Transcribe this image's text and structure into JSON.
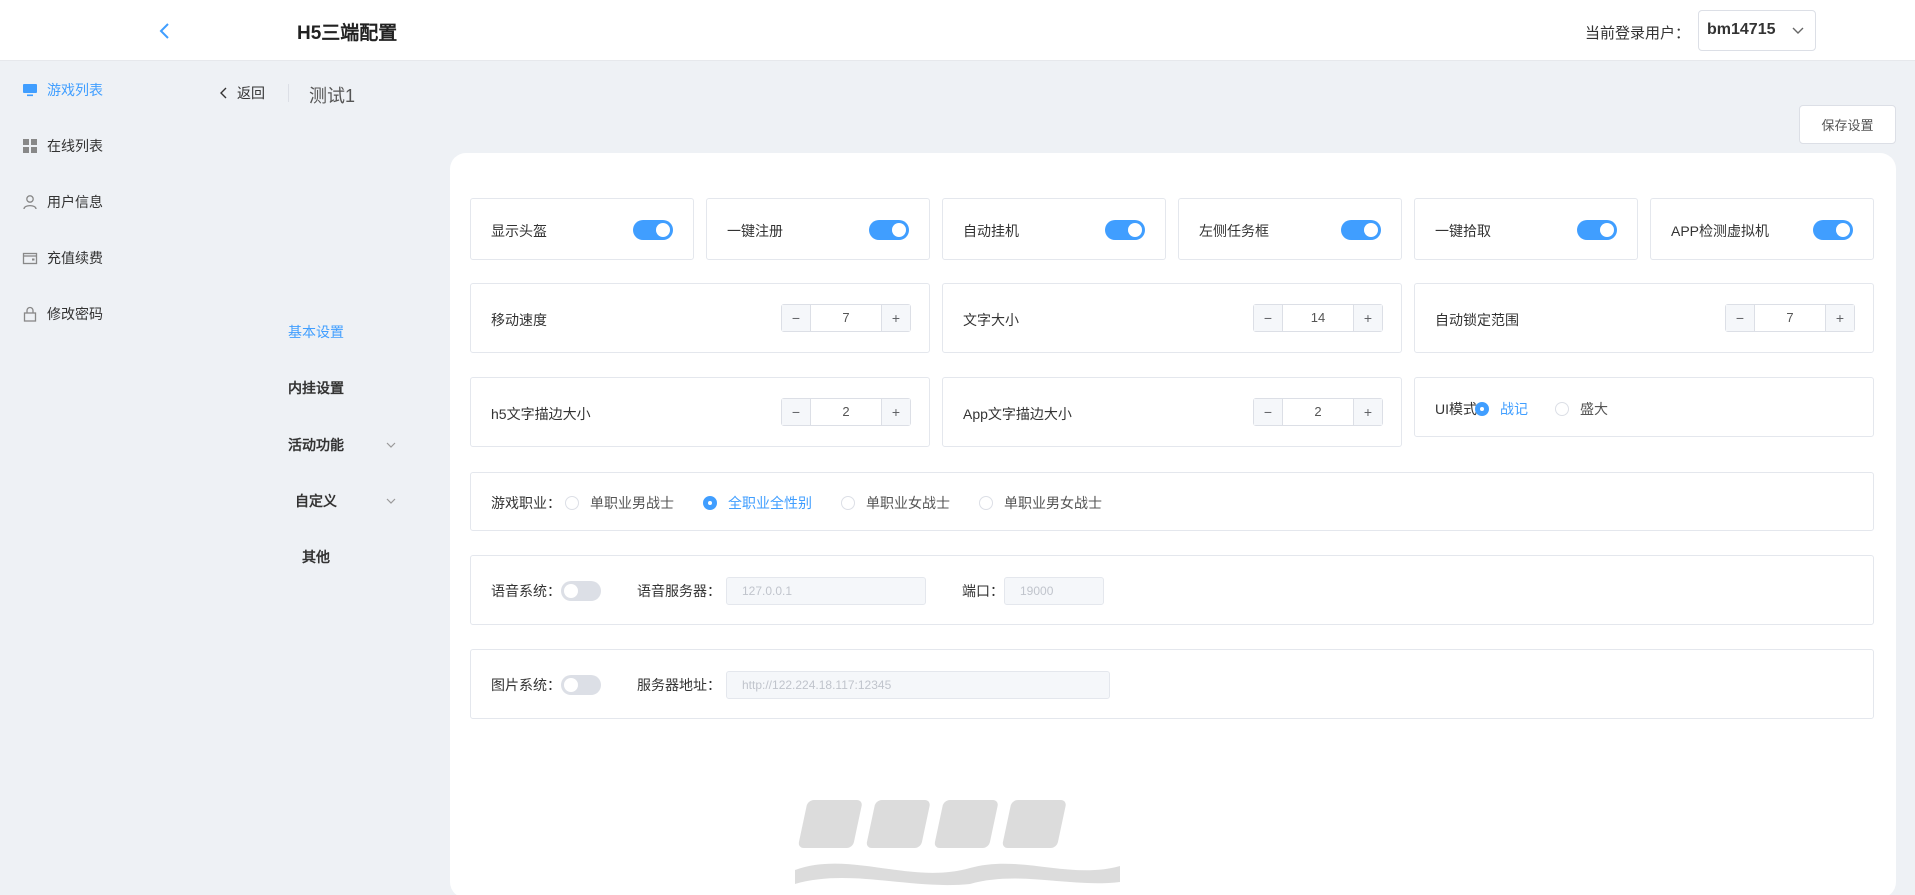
{
  "header": {
    "title": "H5三端配置",
    "user_label": "当前登录用户：",
    "user_value": "bm14715"
  },
  "sidebar": {
    "items": [
      {
        "label": "游戏列表",
        "icon": "monitor-icon"
      },
      {
        "label": "在线列表",
        "icon": "grid-icon"
      },
      {
        "label": "用户信息",
        "icon": "user-icon"
      },
      {
        "label": "充值续费",
        "icon": "wallet-icon"
      },
      {
        "label": "修改密码",
        "icon": "lock-icon"
      }
    ]
  },
  "page": {
    "back_label": "返回",
    "name": "测试1",
    "save_label": "保存设置"
  },
  "submenu": {
    "items": [
      {
        "label": "基本设置"
      },
      {
        "label": "内挂设置"
      },
      {
        "label": "活动功能"
      },
      {
        "label": "自定义"
      },
      {
        "label": "其他"
      }
    ]
  },
  "toggles": [
    {
      "label": "显示头盔",
      "on": true
    },
    {
      "label": "一键注册",
      "on": true
    },
    {
      "label": "自动挂机",
      "on": true
    },
    {
      "label": "左侧任务框",
      "on": true
    },
    {
      "label": "一键拾取",
      "on": true
    },
    {
      "label": "APP检测虚拟机",
      "on": true
    }
  ],
  "steppers": [
    {
      "label": "移动速度",
      "value": "7"
    },
    {
      "label": "文字大小",
      "value": "14"
    },
    {
      "label": "自动锁定范围",
      "value": "7"
    },
    {
      "label": "h5文字描边大小",
      "value": "2"
    },
    {
      "label": "App文字描边大小",
      "value": "2"
    }
  ],
  "stepper_symbols": {
    "minus": "−",
    "plus": "+"
  },
  "ui_mode": {
    "label": "UI模式：",
    "options": [
      {
        "label": "战记",
        "checked": true
      },
      {
        "label": "盛大",
        "checked": false
      }
    ]
  },
  "profession": {
    "label": "游戏职业：",
    "options": [
      {
        "label": "单职业男战士",
        "checked": false
      },
      {
        "label": "全职业全性别",
        "checked": true
      },
      {
        "label": "单职业女战士",
        "checked": false
      },
      {
        "label": "单职业男女战士",
        "checked": false
      }
    ]
  },
  "voice": {
    "label": "语音系统：",
    "on": false,
    "server_label": "语音服务器：",
    "server_value": "127.0.0.1",
    "port_label": "端口：",
    "port_value": "19000"
  },
  "image_system": {
    "label": "图片系统：",
    "on": false,
    "server_label": "服务器地址：",
    "server_value": "http://122.224.18.117:12345"
  },
  "colors": {
    "accent": "#409eff",
    "border": "#e4e7ed",
    "background": "#eef1f5"
  }
}
